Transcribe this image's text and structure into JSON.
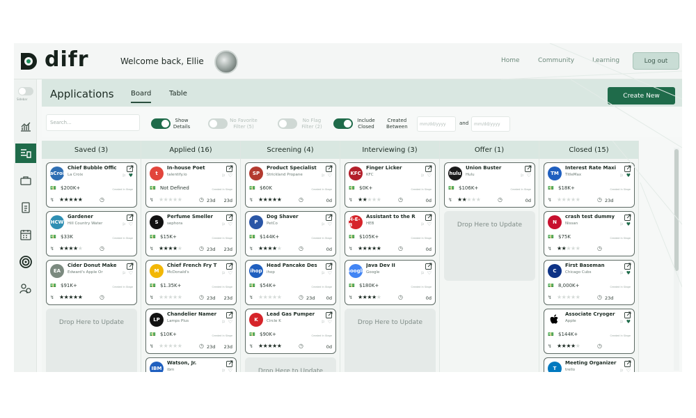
{
  "header": {
    "logo_text": "difr",
    "welcome": "Welcome back, Ellie",
    "nav": [
      "Home",
      "Community",
      "Learning"
    ],
    "logout": "Log out"
  },
  "rail": {
    "toggle_label": "Sidebar",
    "icons": [
      "chart-icon",
      "applications-board-icon",
      "briefcase-icon",
      "document-icon",
      "calendar-icon",
      "target-icon",
      "people-icon"
    ]
  },
  "page": {
    "title": "Applications",
    "tabs": [
      "Board",
      "Table"
    ],
    "active_tab": "Board",
    "create_label": "Create New"
  },
  "filters": {
    "search_placeholder": "Search...",
    "toggles": [
      {
        "label": "Show\nDetails",
        "on": true
      },
      {
        "label": "No Favorite\nFilter (5)",
        "on": false
      },
      {
        "label": "No Flag\nFilter (2)",
        "on": false
      },
      {
        "label": "Include\nClosed",
        "on": true
      }
    ],
    "created_between": "Created\nBetween",
    "date_placeholder": "mm/dd/yyyy",
    "and": "and"
  },
  "card_meta": "Created  In Stage",
  "dropzone_label": "Drop Here to Update",
  "columns": [
    {
      "name": "Saved (3)",
      "cards": [
        {
          "title": "Chief Bubble Offic",
          "company": "La Croix",
          "salary": "$200K+",
          "stars": 5,
          "d1": "",
          "d2": "",
          "logo": "LaCroix",
          "logo_color": "#2f6fb3",
          "fav": true,
          "flag": true
        },
        {
          "title": "Gardener",
          "company": "Hill Country Water",
          "salary": "$33K",
          "stars": 4,
          "d1": "",
          "d2": "",
          "logo": "HCW",
          "logo_color": "#2f8fb3",
          "fav": false,
          "flag": false
        },
        {
          "title": "Cider Donut Make",
          "company": "Edward's Apple Or",
          "salary": "$91K+",
          "stars": 5,
          "d1": "",
          "d2": "",
          "logo": "EA",
          "logo_color": "#7b8a7f",
          "fav": false,
          "flag": false
        }
      ],
      "dropzone": true
    },
    {
      "name": "Applied (16)",
      "cards": [
        {
          "title": "In-house Poet",
          "company": "talentify.io",
          "salary": "Not Defined",
          "stars": 0,
          "d1": "23d",
          "d2": "23d",
          "logo": "t",
          "logo_color": "#e2453c",
          "fav": false,
          "flag": true
        },
        {
          "title": "Perfume Smeller",
          "company": "sephora",
          "salary": "$15K+",
          "stars": 4,
          "d1": "23d",
          "d2": "23d",
          "logo": "S",
          "logo_color": "#111111",
          "fav": false,
          "flag": true
        },
        {
          "title": "Chief French Fry T",
          "company": "McDonald's",
          "salary": "$1.35K+",
          "stars": 0,
          "d1": "23d",
          "d2": "23d",
          "logo": "M",
          "logo_color": "#f2b705",
          "fav": false,
          "flag": true
        },
        {
          "title": "Chandelier Namer",
          "company": "Lamps Plus",
          "salary": "$10K+",
          "stars": 0,
          "d1": "23d",
          "d2": "23d",
          "logo": "LP",
          "logo_color": "#111111",
          "fav": false,
          "flag": true
        },
        {
          "title": "Watson, Jr.",
          "company": "ibm",
          "salary": "",
          "stars": 0,
          "d1": "",
          "d2": "",
          "logo": "IBM",
          "logo_color": "#1f5fbf",
          "fav": false,
          "flag": true
        }
      ],
      "dropzone": false
    },
    {
      "name": "Screening (4)",
      "cards": [
        {
          "title": "Product Specialist",
          "company": "Strickland Propane",
          "salary": "$60K",
          "stars": 5,
          "d1": "",
          "d2": "0d",
          "logo": "SP",
          "logo_color": "#b33a2f",
          "fav": false,
          "flag": true
        },
        {
          "title": "Dog Shaver",
          "company": "PetCo",
          "salary": "$144K+",
          "stars": 4,
          "d1": "",
          "d2": "0d",
          "logo": "P",
          "logo_color": "#2a56a6",
          "fav": false,
          "flag": true
        },
        {
          "title": "Head Pancake Des",
          "company": "ihop",
          "salary": "$54K+",
          "stars": 0,
          "d1": "23d",
          "d2": "0d",
          "logo": "ihop",
          "logo_color": "#1f5fbf",
          "fav": false,
          "flag": true
        },
        {
          "title": "Lead Gas Pumper",
          "company": "Circle K",
          "salary": "$90K+",
          "stars": 5,
          "d1": "",
          "d2": "0d",
          "logo": "K",
          "logo_color": "#d6242a",
          "fav": false,
          "flag": true
        }
      ],
      "dropzone": true
    },
    {
      "name": "Interviewing (3)",
      "cards": [
        {
          "title": "Finger Licker",
          "company": "KFC",
          "salary": "$0K+",
          "stars": 2,
          "d1": "",
          "d2": "0d",
          "logo": "KFC",
          "logo_color": "#b31f2a",
          "fav": false,
          "flag": true
        },
        {
          "title": "Assistant to the R",
          "company": "HEB",
          "salary": "$105K+",
          "stars": 5,
          "d1": "",
          "d2": "0d",
          "logo": "H-E-B",
          "logo_color": "#d6242a",
          "fav": false,
          "flag": true
        },
        {
          "title": "Java Dev II",
          "company": "Google",
          "salary": "$180K+",
          "stars": 4,
          "d1": "",
          "d2": "0d",
          "logo": "Google",
          "logo_color": "#4285f4",
          "fav": false,
          "flag": true
        }
      ],
      "dropzone": true
    },
    {
      "name": "Offer (1)",
      "cards": [
        {
          "title": "Union Buster",
          "company": "Hulu",
          "salary": "$106K+",
          "stars": 2,
          "d1": "",
          "d2": "0d",
          "logo": "hulu",
          "logo_color": "#1a1a1a",
          "fav": false,
          "flag": true
        }
      ],
      "dropzone": true
    },
    {
      "name": "Closed (15)",
      "cards": [
        {
          "title": "Interest Rate Maxi",
          "company": "TitleMax",
          "salary": "$18K+",
          "stars": 0,
          "d1": "23d",
          "d2": "",
          "logo": "TM",
          "logo_color": "#1f5fbf",
          "fav": true,
          "flag": true
        },
        {
          "title": "crash test dummy",
          "company": "Nissan",
          "salary": "$75K",
          "stars": 2,
          "d1": "",
          "d2": "",
          "logo": "N",
          "logo_color": "#c8102e",
          "fav": true,
          "flag": true
        },
        {
          "title": "First Baseman",
          "company": "Chicago Cubs",
          "salary": "8,000K+",
          "stars": 0,
          "d1": "23d",
          "d2": "",
          "logo": "C",
          "logo_color": "#0e3386",
          "fav": true,
          "flag": true
        },
        {
          "title": "Associate Cryoger",
          "company": "Apple",
          "salary": "$144K+",
          "stars": 4,
          "d1": "",
          "d2": "",
          "logo": "",
          "logo_color": "#ffffff",
          "fav": true,
          "flag": true
        },
        {
          "title": "Meeting Organizer",
          "company": "trello",
          "salary": "",
          "stars": 0,
          "d1": "",
          "d2": "",
          "logo": "T",
          "logo_color": "#0079bf",
          "fav": false,
          "flag": true
        }
      ],
      "dropzone": false
    }
  ],
  "colors": {
    "brand": "#1f6b4a",
    "header_bg": "#d9e7e1",
    "page_bg": "#f6f8f7"
  }
}
